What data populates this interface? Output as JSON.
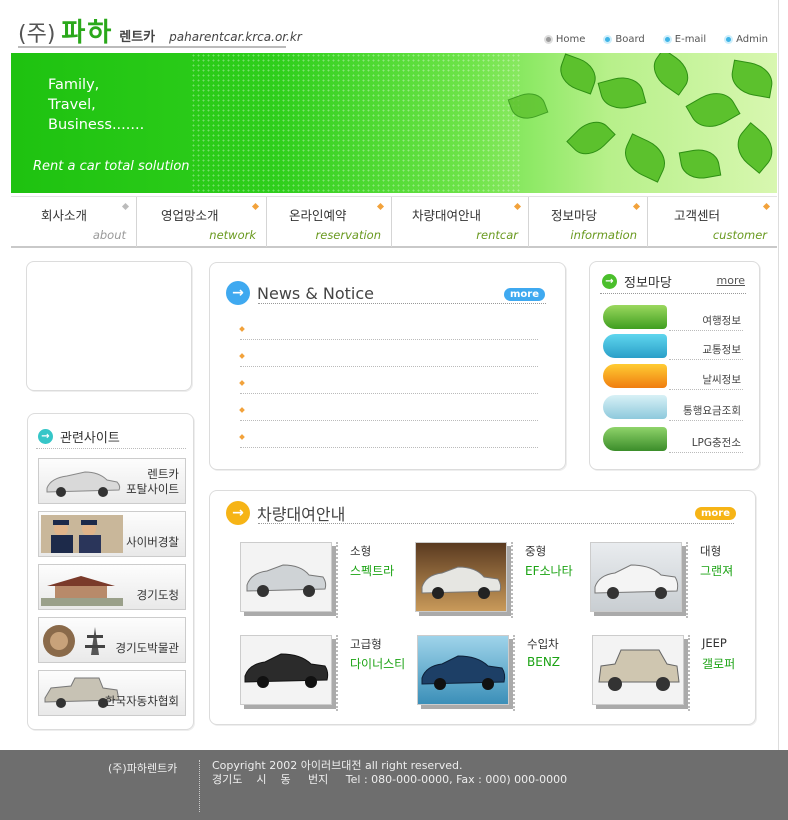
{
  "header": {
    "logo_paren": "(주)",
    "logo_name": "파하",
    "logo_sub": "렌트카",
    "url": "paharentcar.krca.or.kr",
    "links": [
      {
        "label": "Home",
        "color": "#9a9a9a"
      },
      {
        "label": "Board",
        "color": "#3fb4e6"
      },
      {
        "label": "E-mail",
        "color": "#3fb4e6"
      },
      {
        "label": "Admin",
        "color": "#3fb4e6"
      }
    ]
  },
  "banner": {
    "line1": "Family,",
    "line2": "Travel,",
    "line3": "Business.......",
    "tagline": "Rent a car total solution"
  },
  "nav": [
    {
      "ko": "회사소개",
      "en": "about"
    },
    {
      "ko": "영업망소개",
      "en": "network"
    },
    {
      "ko": "온라인예약",
      "en": "reservation"
    },
    {
      "ko": "차량대여안내",
      "en": "rentcar"
    },
    {
      "ko": "정보마당",
      "en": "information"
    },
    {
      "ko": "고객센터",
      "en": "customer"
    }
  ],
  "related": {
    "title": "관련사이트",
    "items": [
      {
        "line1": "렌트카",
        "line2": "포탈사이트"
      },
      {
        "line1": "",
        "line2": "사이버경찰"
      },
      {
        "line1": "",
        "line2": "경기도청"
      },
      {
        "line1": "",
        "line2": "경기도박물관"
      },
      {
        "line1": "",
        "line2": "한국자동차협회"
      }
    ]
  },
  "news": {
    "title": "News & Notice",
    "more": "more"
  },
  "info": {
    "title": "정보마당",
    "more": "more",
    "items": [
      {
        "label": "여행정보"
      },
      {
        "label": "교통정보"
      },
      {
        "label": "날씨정보"
      },
      {
        "label": "통행요금조회"
      },
      {
        "label": "LPG충전소"
      }
    ]
  },
  "rental": {
    "title": "차량대여안내",
    "more": "more",
    "cars": [
      {
        "cat": "소형",
        "name": "스펙트라"
      },
      {
        "cat": "중형",
        "name": "EF소나타"
      },
      {
        "cat": "대형",
        "name": "그랜져"
      },
      {
        "cat": "고급형",
        "name": "다이너스티"
      },
      {
        "cat": "수입차",
        "name": "BENZ"
      },
      {
        "cat": "JEEP",
        "name": "갤로퍼"
      }
    ]
  },
  "footer": {
    "company": "(주)파하렌트카",
    "copyright": "Copyright 2002 아이러브대전 all right reserved.",
    "address": "경기도    시    동     번지     Tel : 080-000-0000, Fax : 000) 000-0000"
  }
}
